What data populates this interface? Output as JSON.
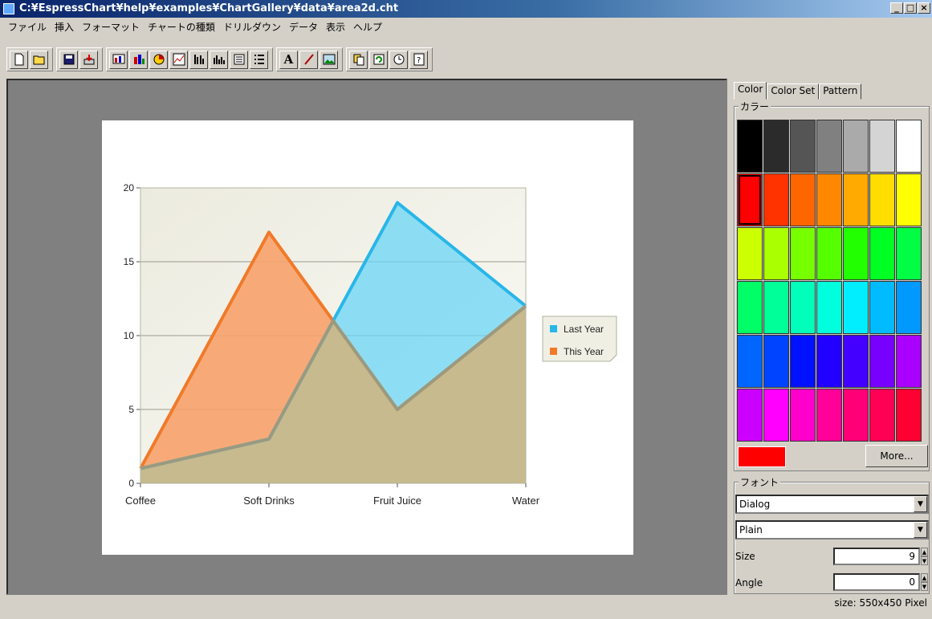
{
  "window": {
    "title": "C:¥EspressChart¥help¥examples¥ChartGallery¥data¥area2d.cht",
    "min": "_",
    "max": "□",
    "close": "×"
  },
  "menu": [
    "ファイル",
    "挿入",
    "フォーマット",
    "チャートの種類",
    "ドリルダウン",
    "データ",
    "表示",
    "ヘルプ"
  ],
  "toolbar": {
    "groups": [
      [
        "new-icon",
        "open-icon"
      ],
      [
        "save-icon",
        "export-icon"
      ],
      [
        "data-source-icon",
        "chart-type-icon",
        "pie-icon",
        "line-chart-icon",
        "axis-scale-icon",
        "histogram-icon",
        "legend-icon",
        "list-icon"
      ],
      [
        "text-icon",
        "pen-icon",
        "image-icon"
      ],
      [
        "copy-icon",
        "refresh-icon",
        "clock-icon",
        "help-icon"
      ]
    ],
    "text_button": "A"
  },
  "chart_data": {
    "type": "area",
    "categories": [
      "Coffee",
      "Soft Drinks",
      "Fruit Juice",
      "Water"
    ],
    "series": [
      {
        "name": "Last Year",
        "values": [
          1,
          3,
          19,
          12
        ],
        "color": "#29b6e8"
      },
      {
        "name": "This Year",
        "values": [
          1,
          17,
          5,
          12
        ],
        "color": "#f07a2a"
      }
    ],
    "ylim": [
      0,
      20
    ],
    "yticks": [
      "0",
      "5",
      "10",
      "15",
      "20"
    ],
    "legend_position": "right",
    "grid": true
  },
  "panel": {
    "tabs": [
      "Color",
      "Color Set",
      "Pattern"
    ],
    "color_group": "カラー",
    "swatches": [
      "#000000",
      "#2b2b2b",
      "#555555",
      "#808080",
      "#aaaaaa",
      "#d4d4d4",
      "#ffffff",
      "#ff0000",
      "#ff3300",
      "#ff6600",
      "#ff8800",
      "#ffaa00",
      "#ffdd00",
      "#ffff00",
      "#ccff00",
      "#aaff00",
      "#77ff00",
      "#55ff00",
      "#22ff00",
      "#00ff22",
      "#00ff44",
      "#00ff66",
      "#00ff99",
      "#00ffbb",
      "#00ffdd",
      "#00eeff",
      "#00bbff",
      "#0099ff",
      "#0066ff",
      "#0044ff",
      "#0011ff",
      "#2200ff",
      "#4400ff",
      "#7700ff",
      "#aa00ff",
      "#cc00ff",
      "#ff00ff",
      "#ff00cc",
      "#ff0099",
      "#ff0077",
      "#ff0055",
      "#ff0033"
    ],
    "selected_swatch": 7,
    "current_color": "#ff0000",
    "more_button": "More...",
    "font_group": "フォント",
    "font_name": "Dialog",
    "font_style": "Plain",
    "size_label": "Size",
    "size_value": "9",
    "angle_label": "Angle",
    "angle_value": "0"
  },
  "status": {
    "size_text": "size: 550x450 Pixel"
  }
}
